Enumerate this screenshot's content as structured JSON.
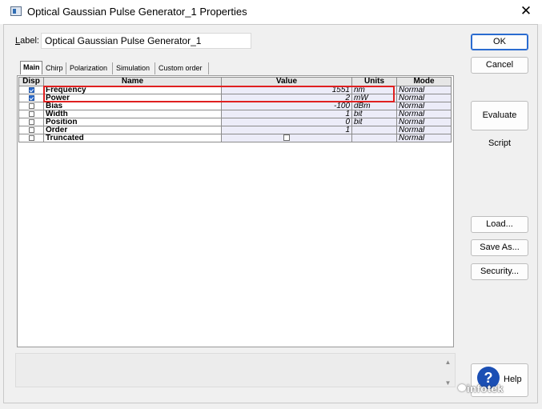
{
  "window": {
    "title": "Optical Gaussian Pulse Generator_1 Properties"
  },
  "label": {
    "prefix": "L",
    "rest": "abel:",
    "value": "Optical Gaussian Pulse Generator_1"
  },
  "buttons": {
    "ok": "OK",
    "cancel": "Cancel",
    "evaluate_script": "Evaluate Script",
    "load": "Load...",
    "save_as": "Save As...",
    "security": "Security...",
    "help": "Help"
  },
  "tabs": [
    "Main",
    "Chirp",
    "Polarization",
    "Simulation",
    "Custom order"
  ],
  "table": {
    "headers": [
      "Disp",
      "Name",
      "Value",
      "Units",
      "Mode"
    ],
    "rows": [
      {
        "disp": true,
        "name": "Frequency",
        "value": "1551",
        "units": "nm",
        "mode": "Normal"
      },
      {
        "disp": true,
        "name": "Power",
        "value": "2",
        "units": "mW",
        "mode": "Normal"
      },
      {
        "disp": false,
        "name": "Bias",
        "value": "-100",
        "units": "dBm",
        "mode": "Normal"
      },
      {
        "disp": false,
        "name": "Width",
        "value": "1",
        "units": "bit",
        "mode": "Normal"
      },
      {
        "disp": false,
        "name": "Position",
        "value": "0",
        "units": "bit",
        "mode": "Normal"
      },
      {
        "disp": false,
        "name": "Order",
        "value": "1",
        "units": "",
        "mode": "Normal"
      },
      {
        "disp": false,
        "name": "Truncated",
        "value": "",
        "units": "",
        "mode": "Normal",
        "value_checkbox": true
      }
    ]
  },
  "watermark": "infotek",
  "colors": {
    "highlight": "#e02020",
    "accent": "#2a6bd0"
  }
}
